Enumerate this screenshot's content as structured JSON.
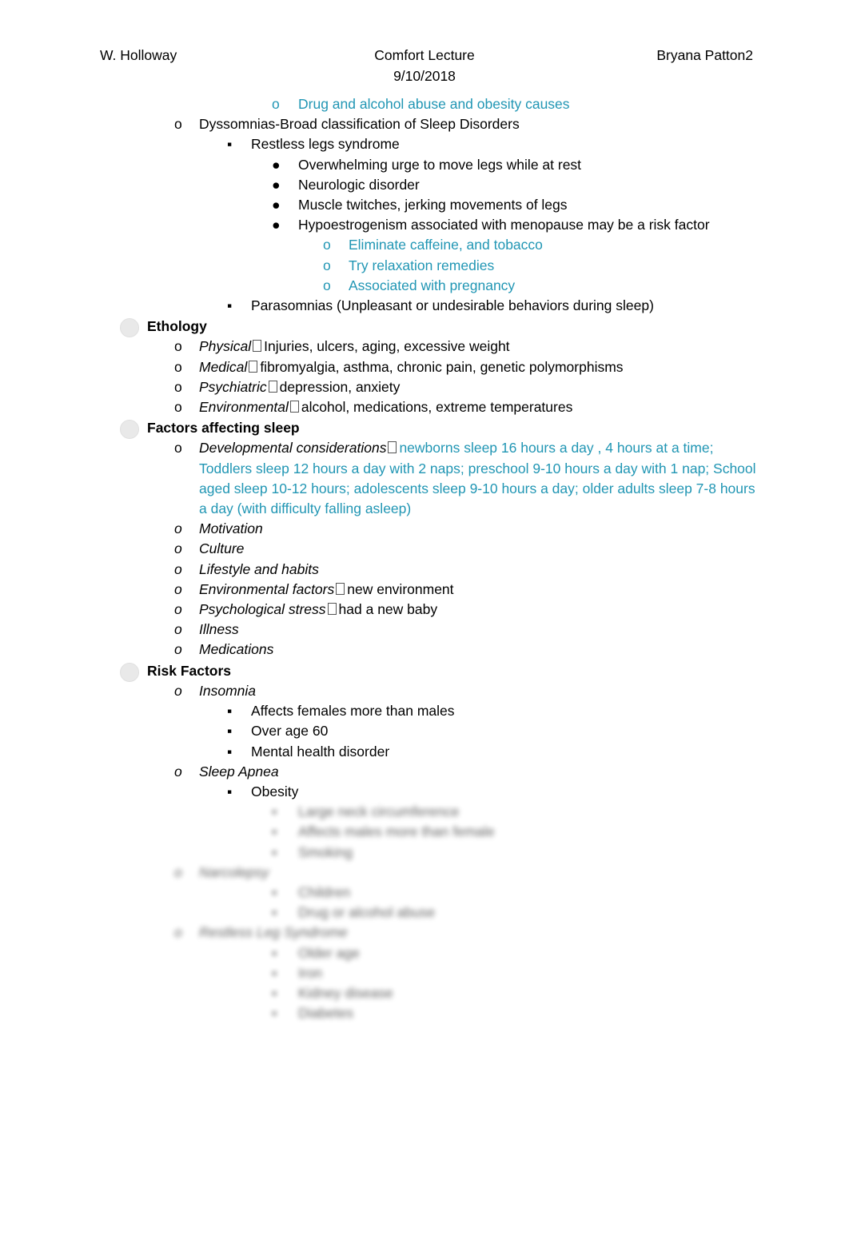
{
  "header": {
    "left": "W. Holloway",
    "center": "Comfort Lecture",
    "right": "Bryana Patton2",
    "date": "9/10/2018"
  },
  "bullets": {
    "circle": "o",
    "square": "▪",
    "disc": "●"
  },
  "outline": [
    {
      "level": 4,
      "bullet": "o",
      "text": "Drug and alcohol abuse and obesity causes",
      "color": "teal"
    },
    {
      "level": 2,
      "bullet": "o",
      "text": "Dyssomnias-Broad classification of Sleep Disorders",
      "color": "black"
    },
    {
      "level": 3,
      "bullet": "▪",
      "text": "Restless legs syndrome",
      "color": "black"
    },
    {
      "level": 4,
      "bullet": "●",
      "text": "Overwhelming urge to move legs while at rest",
      "color": "black"
    },
    {
      "level": 4,
      "bullet": "●",
      "text": "Neurologic disorder",
      "color": "black"
    },
    {
      "level": 4,
      "bullet": "●",
      "text": "Muscle twitches, jerking movements of legs",
      "color": "black"
    },
    {
      "level": 4,
      "bullet": "●",
      "text": "Hypoestrogenism associated with menopause may be a risk factor",
      "color": "black"
    },
    {
      "level": 5,
      "bullet": "o",
      "text": "Eliminate caffeine, and tobacco",
      "color": "teal"
    },
    {
      "level": 5,
      "bullet": "o",
      "text": "Try relaxation remedies",
      "color": "teal"
    },
    {
      "level": 5,
      "bullet": "o",
      "text": "Associated with pregnancy",
      "color": "teal"
    },
    {
      "level": 3,
      "bullet": "▪",
      "text": "Parasomnias (Unpleasant or undesirable behaviors during sleep)",
      "color": "black"
    }
  ],
  "sections": [
    {
      "heading": "Ethology",
      "items": [
        {
          "lead": "Physical",
          "rest": "Injuries, ulcers, aging, excessive weight"
        },
        {
          "lead": "Medical",
          "rest": "fibromyalgia, asthma, chronic pain, genetic polymorphisms"
        },
        {
          "lead": "Psychiatric",
          "rest": "depression, anxiety"
        },
        {
          "lead": "Environmental",
          "rest": "alcohol, medications, extreme temperatures"
        }
      ]
    }
  ],
  "factors": {
    "heading": "Factors affecting sleep",
    "dev_lead": "Developmental considerations",
    "dev_rest": "newborns sleep 16 hours a day , 4 hours at a time; Toddlers sleep 12 hours a day with 2 naps; preschool 9-10 hours a day with 1 nap; School aged sleep 10-12 hours; adolescents sleep 9-10 hours a day; older adults sleep 7-8 hours a day (with difficulty falling asleep)",
    "items": [
      {
        "lead": "Motivation",
        "rest": ""
      },
      {
        "lead": "Culture",
        "rest": ""
      },
      {
        "lead": "Lifestyle and habits",
        "rest": ""
      },
      {
        "lead": "Environmental factors",
        "rest": "new environment"
      },
      {
        "lead": "Psychological stress",
        "rest": "had a new baby"
      },
      {
        "lead": "Illness",
        "rest": ""
      },
      {
        "lead": "Medications",
        "rest": ""
      }
    ]
  },
  "risk": {
    "heading": "Risk Factors",
    "groups": [
      {
        "lead": "Insomnia",
        "subs": [
          "Affects females more than males",
          "Over age 60",
          "Mental health disorder"
        ]
      },
      {
        "lead": "Sleep Apnea",
        "subs": [
          "Obesity"
        ]
      }
    ]
  },
  "obscured": [
    {
      "level": 4,
      "bullet": "▪",
      "text": "Large neck circumference"
    },
    {
      "level": 4,
      "bullet": "▪",
      "text": "Affects males more than female"
    },
    {
      "level": 4,
      "bullet": "▪",
      "text": "Smoking"
    },
    {
      "level": 3,
      "bullet": "o",
      "text": "Narcolepsy"
    },
    {
      "level": 4,
      "bullet": "▪",
      "text": "Children"
    },
    {
      "level": 4,
      "bullet": "▪",
      "text": "Drug or alcohol abuse"
    },
    {
      "level": 3,
      "bullet": "o",
      "text": "Restless Leg Syndrome"
    },
    {
      "level": 4,
      "bullet": "▪",
      "text": "Older age"
    },
    {
      "level": 4,
      "bullet": "▪",
      "text": "Iron"
    },
    {
      "level": 4,
      "bullet": "▪",
      "text": "Kidney disease"
    },
    {
      "level": 4,
      "bullet": "▪",
      "text": "Diabetes"
    }
  ]
}
